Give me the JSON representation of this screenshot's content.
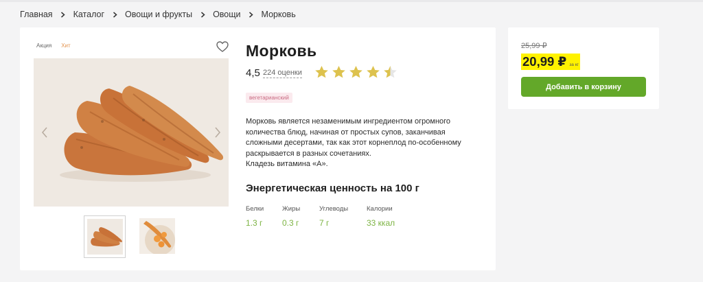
{
  "breadcrumb": [
    "Главная",
    "Каталог",
    "Овощи и фрукты",
    "Овощи",
    "Морковь"
  ],
  "product": {
    "badges": {
      "sale": "Акция",
      "hit": "Хит"
    },
    "title": "Морковь",
    "rating": "4,5",
    "rating_stars": 4.5,
    "reviews": "224 оценки",
    "tag": "вегетарианский",
    "description": [
      "Морковь является незаменимым ингредиентом огромного",
      "количества блюд, начиная от простых супов, заканчивая",
      "сложными десертами, так как этот корнеплод по-особенному",
      "раскрывается в разных сочетаниях.",
      "Кладезь витамина «А»."
    ],
    "energy_title": "Энергетическая ценность на 100 г",
    "nutrition": [
      {
        "label": "Белки",
        "value": "1.3 г"
      },
      {
        "label": "Жиры",
        "value": "0.3 г"
      },
      {
        "label": "Углеводы",
        "value": "7 г"
      },
      {
        "label": "Калории",
        "value": "33 ккал"
      }
    ]
  },
  "price": {
    "old": "25,99 ₽",
    "current": "20,99 ₽",
    "unit": "за кг",
    "buy_label": "Добавить в корзину"
  },
  "colors": {
    "accent_green": "#63a829",
    "price_highlight": "#fff200",
    "star": "#ddc24e",
    "nutrition_value": "#7cb342"
  },
  "icons": [
    "chevron-right-icon",
    "heart-icon",
    "star-icon",
    "arrow-left-icon",
    "arrow-right-icon"
  ]
}
